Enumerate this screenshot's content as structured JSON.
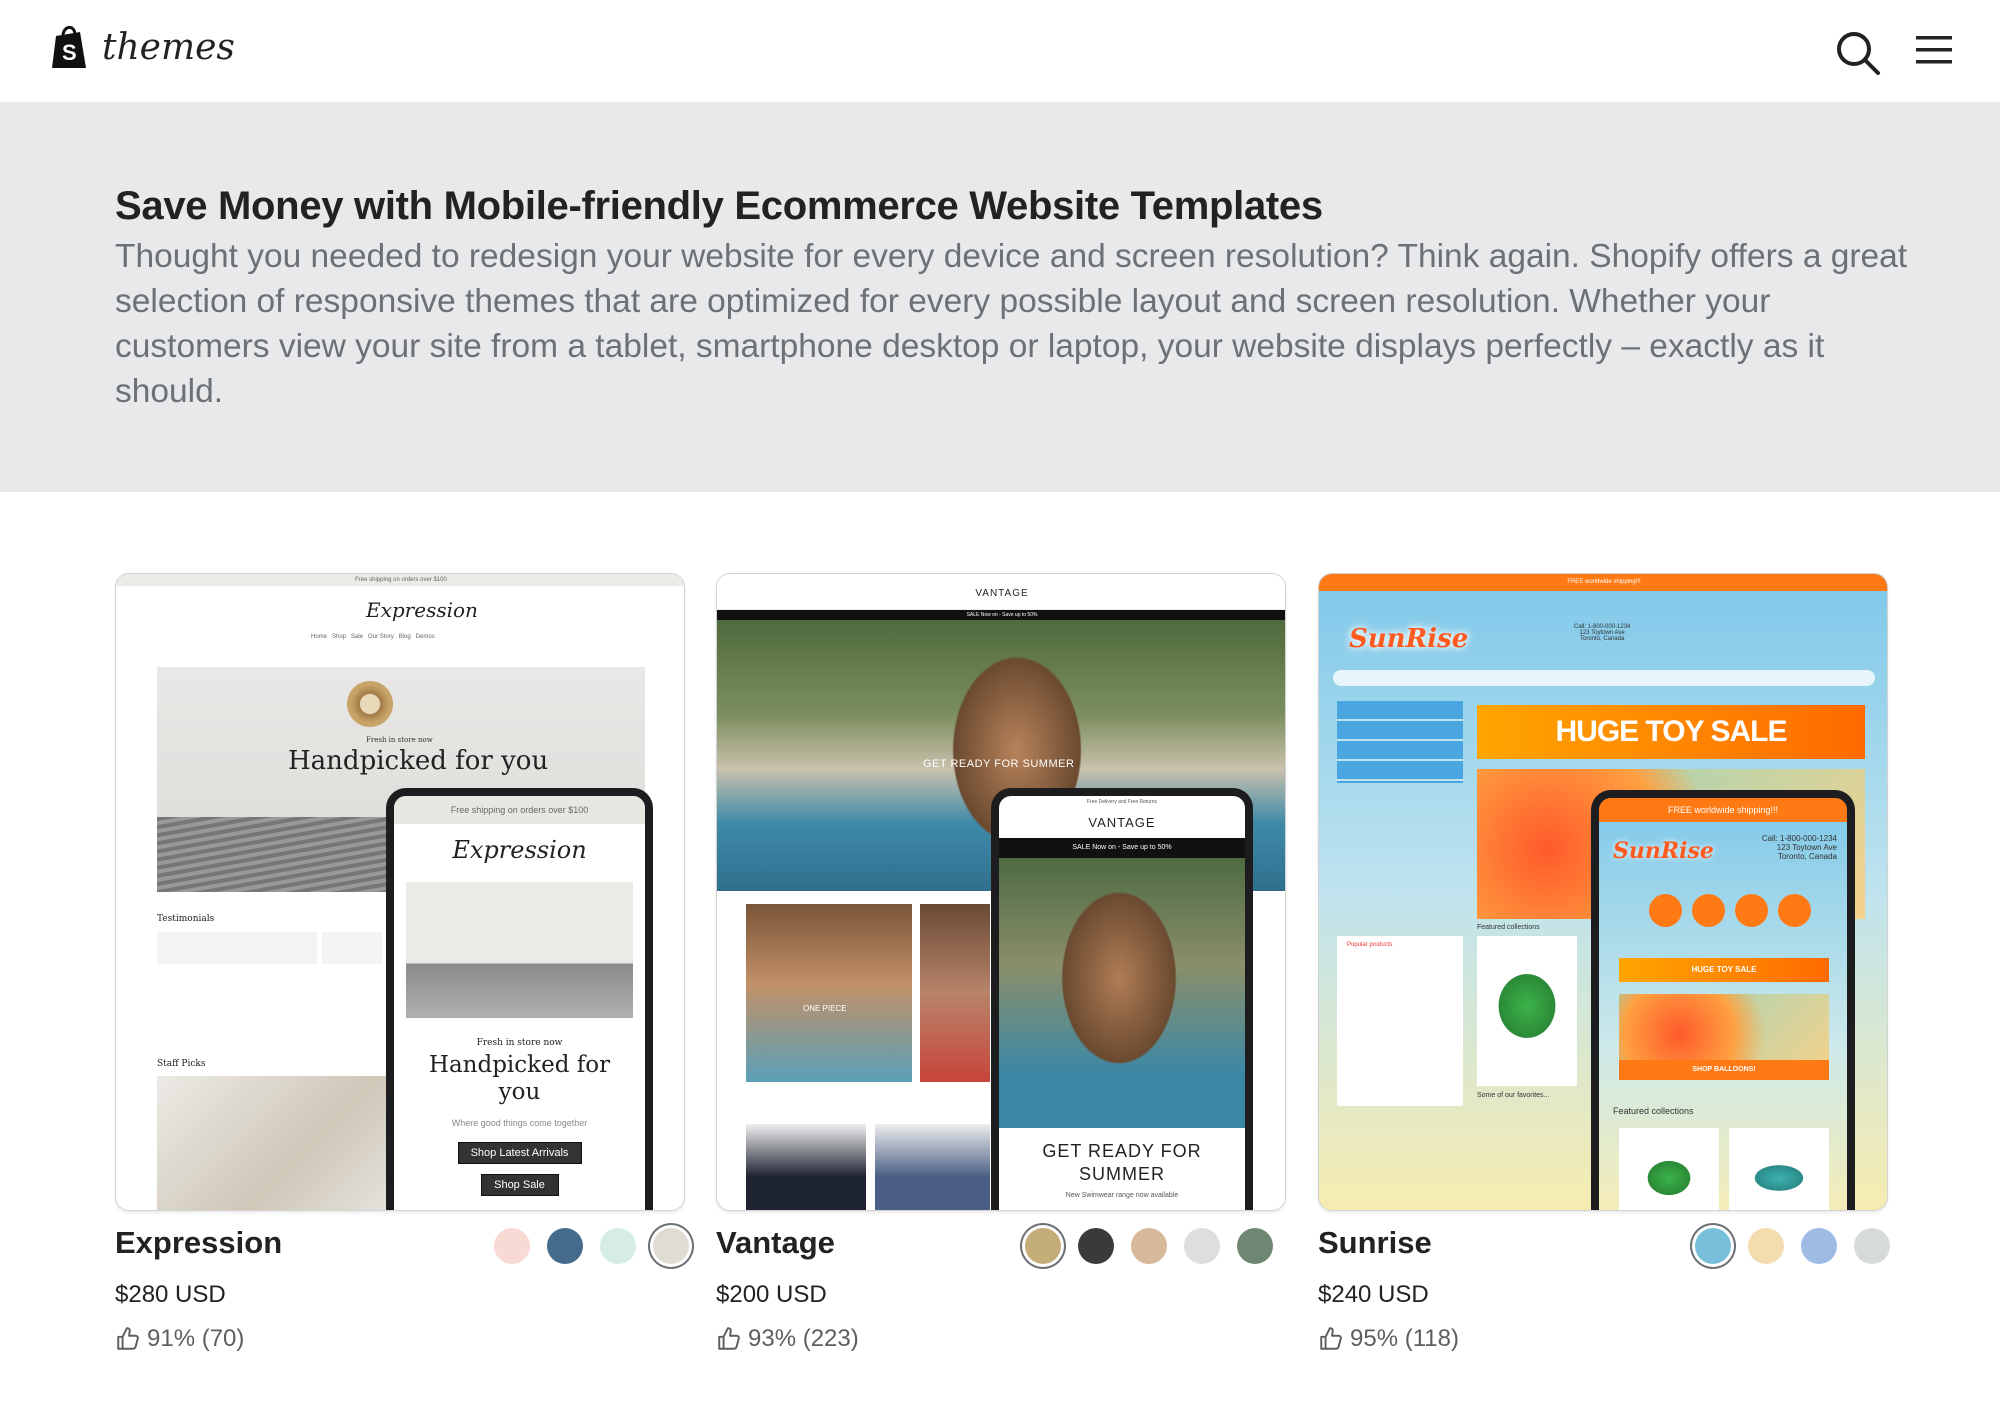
{
  "header": {
    "logo_text": "themes",
    "logo_icon": "shopify-bag-icon",
    "search_icon": "search-icon",
    "menu_icon": "hamburger-menu-icon"
  },
  "banner": {
    "title": "Save Money with Mobile-friendly Ecommerce Website Templates",
    "description": "Thought you needed to redesign your website for every device and screen resolution? Think again. Shopify offers a great selection of responsive themes that are optimized for every possible layout and screen resolution. Whether your customers view your site from a tablet, smartphone desktop or laptop, your website displays perfectly – exactly as it should."
  },
  "themes": [
    {
      "name": "Expression",
      "price": "$280 USD",
      "rating": "91% (70)",
      "swatches": [
        "#f9d9d3",
        "#456b8c",
        "#d6ede3",
        "#e0dbd3"
      ],
      "selected_swatch": 3,
      "preview": {
        "announcement": "Free shipping on orders over $100",
        "logo": "Expression",
        "nav": "Home   Shop   Sale   Our Story   Blog   Demos",
        "eyebrow": "Fresh in store now",
        "headline": "Handpicked for you",
        "subhead": "Where good things come together",
        "cta1": "Shop Latest Arrivals",
        "cta2": "Shop Sale",
        "testimonials": "Testimonials",
        "staff_picks": "Staff Picks"
      }
    },
    {
      "name": "Vantage",
      "price": "$200 USD",
      "rating": "93% (223)",
      "swatches": [
        "#c4ad78",
        "#3a3a3a",
        "#d6b89b",
        "#dedede",
        "#6e8672"
      ],
      "selected_swatch": 0,
      "preview": {
        "logo": "VANTAGE",
        "sale_bar": "SALE Now on - Save up to 50%",
        "hero": "GET READY FOR SUMMER",
        "phone_top": "Free Delivery and Free Returns",
        "phone_headline": "GET READY FOR SUMMER",
        "phone_sub": "New Swimwear range now available",
        "tile": "ONE PIECE"
      }
    },
    {
      "name": "Sunrise",
      "price": "$240 USD",
      "rating": "95% (118)",
      "swatches": [
        "#78bfdc",
        "#f3dcae",
        "#9dbbe5",
        "#d5dadb"
      ],
      "selected_swatch": 0,
      "preview": {
        "shipping": "FREE worldwide shipping!!!",
        "logo": "SunRise",
        "contact": "Call: 1-800-000-1234\n123 Toytown Ave\nToronto, Canada",
        "sale": "HUGE TOY SALE",
        "featured": "Featured collections",
        "favorites": "Some of our favorites...",
        "popular": "Popular products",
        "balloons": "SHOP BALLOONS!"
      }
    }
  ]
}
